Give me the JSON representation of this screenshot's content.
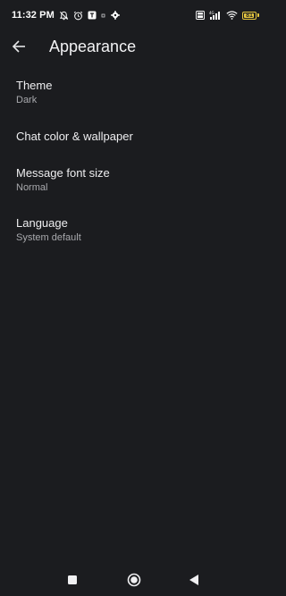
{
  "status_bar": {
    "time": "11:32 PM",
    "icons_left": [
      "muted-bell-icon",
      "alarm-clock-icon",
      "app-notification-icon",
      "dot-icon",
      "gear-icon"
    ],
    "icons_right": [
      "volte-icon",
      "signal-icon",
      "wifi-icon",
      "battery-icon"
    ],
    "volte_label": "Vo LTE",
    "battery_level": "81"
  },
  "app_bar": {
    "title": "Appearance",
    "back_icon": "arrow-left-icon"
  },
  "settings": {
    "items": [
      {
        "title": "Theme",
        "subtitle": "Dark"
      },
      {
        "title": "Chat color & wallpaper",
        "subtitle": ""
      },
      {
        "title": "Message font size",
        "subtitle": "Normal"
      },
      {
        "title": "Language",
        "subtitle": "System default"
      }
    ]
  },
  "nav_bar": {
    "buttons": [
      "recents-square-icon",
      "home-circle-icon",
      "back-triangle-icon"
    ]
  },
  "colors": {
    "background": "#1b1c1f",
    "text_primary": "#eeeef0",
    "text_secondary": "#a8a9ad",
    "battery_accent": "#e8c840"
  }
}
